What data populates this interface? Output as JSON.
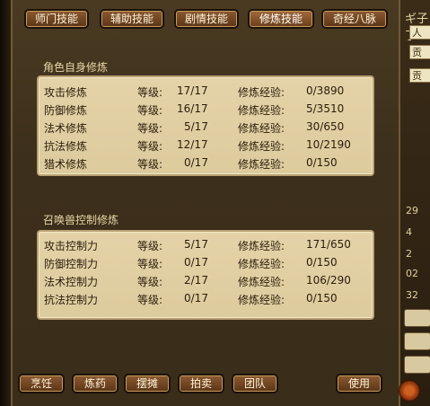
{
  "tabs": [
    {
      "label": "师门技能",
      "active": false
    },
    {
      "label": "辅助技能",
      "active": false
    },
    {
      "label": "剧情技能",
      "active": false
    },
    {
      "label": "修炼技能",
      "active": true
    },
    {
      "label": "奇经八脉",
      "active": false
    }
  ],
  "self_section": {
    "title": "角色自身修炼",
    "rows": [
      {
        "name": "攻击修炼",
        "level_label": "等级:",
        "level": "17/17",
        "exp_label": "修炼经验:",
        "exp": "0/3890"
      },
      {
        "name": "防御修炼",
        "level_label": "等级:",
        "level": "16/17",
        "exp_label": "修炼经验:",
        "exp": "5/3510"
      },
      {
        "name": "法术修炼",
        "level_label": "等级:",
        "level": "5/17",
        "exp_label": "修炼经验:",
        "exp": "30/650"
      },
      {
        "name": "抗法修炼",
        "level_label": "等级:",
        "level": "12/17",
        "exp_label": "修炼经验:",
        "exp": "10/2190"
      },
      {
        "name": "猎术修炼",
        "level_label": "等级:",
        "level": "0/17",
        "exp_label": "修炼经验:",
        "exp": "0/150"
      }
    ]
  },
  "pet_section": {
    "title": "召唤兽控制修炼",
    "rows": [
      {
        "name": "攻击控制力",
        "level_label": "等级:",
        "level": "5/17",
        "exp_label": "修炼经验:",
        "exp": "171/650"
      },
      {
        "name": "防御控制力",
        "level_label": "等级:",
        "level": "0/17",
        "exp_label": "修炼经验:",
        "exp": "0/150"
      },
      {
        "name": "法术控制力",
        "level_label": "等级:",
        "level": "2/17",
        "exp_label": "修炼经验:",
        "exp": "106/290"
      },
      {
        "name": "抗法控制力",
        "level_label": "等级:",
        "level": "0/17",
        "exp_label": "修炼经验:",
        "exp": "0/150"
      }
    ]
  },
  "bottom_buttons": [
    "烹饪",
    "炼药",
    "摆摊",
    "拍卖",
    "团队"
  ],
  "use_button": "使用",
  "background_window": {
    "title_fragment": "ギ子了",
    "box_texts": [
      "人",
      "贡",
      "贡"
    ],
    "numbers": [
      "29",
      "4",
      "2",
      "02",
      "32"
    ]
  }
}
